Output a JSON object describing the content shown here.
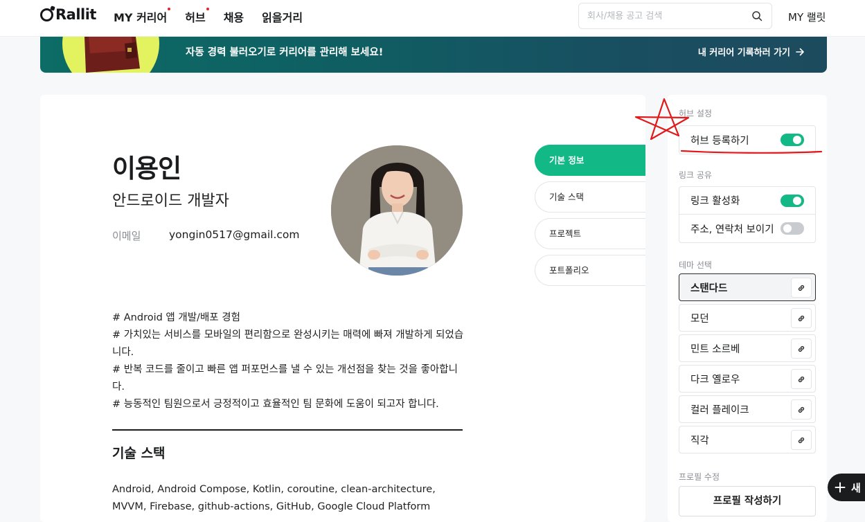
{
  "header": {
    "logo": "Rallit",
    "nav": [
      {
        "label": "MY 커리어",
        "dot": true
      },
      {
        "label": "허브",
        "dot": true
      },
      {
        "label": "채용",
        "dot": false
      },
      {
        "label": "읽을거리",
        "dot": false
      }
    ],
    "search_placeholder": "회사/채용 공고 검색",
    "my_rallit": "MY 랠릿"
  },
  "banner": {
    "text": "자동 경력 불러오기로 커리어를 관리해 보세요!",
    "link": "내 커리어 기록하러 가기"
  },
  "profile": {
    "name": "이용인",
    "role": "안드로이드 개발자",
    "email_label": "이메일",
    "email": "yongin0517@gmail.com",
    "intro": [
      "# Android 앱 개발/배포 경험",
      "# 가치있는 서비스를 모바일의 편리함으로 완성시키는 매력에 빠져 개발하게 되었습니다.",
      "# 반복 코드를 줄이고 빠른 앱 퍼포먼스를 낼 수 있는 개선점을 찾는 것을 좋아합니다.",
      "# 능동적인 팀원으로서 긍정적이고 효율적인 팀 문화에 도움이 되고자 합니다."
    ],
    "skills_title": "기술 스택",
    "skills": "Android, Android Compose, Kotlin, coroutine, clean-architecture, MVVM, Firebase, github-actions, GitHub, Google Cloud Platform"
  },
  "section_tabs": [
    {
      "label": "기본 정보",
      "active": true
    },
    {
      "label": "기술 스택",
      "active": false
    },
    {
      "label": "프로젝트",
      "active": false
    },
    {
      "label": "포트폴리오",
      "active": false
    }
  ],
  "settings": {
    "hub_label": "허브 설정",
    "hub_register": {
      "label": "허브 등록하기",
      "on": true
    },
    "link_label": "링크 공유",
    "link_active": {
      "label": "링크 활성화",
      "on": true
    },
    "contact_show": {
      "label": "주소, 연락처 보이기",
      "on": false
    },
    "theme_label": "테마 선택",
    "themes": [
      {
        "label": "스탠다드",
        "selected": true
      },
      {
        "label": "모던",
        "selected": false
      },
      {
        "label": "민트 소르베",
        "selected": false
      },
      {
        "label": "다크 옐로우",
        "selected": false
      },
      {
        "label": "컬러 플레이크",
        "selected": false
      },
      {
        "label": "직각",
        "selected": false
      }
    ],
    "profile_edit_label": "프로필 수정",
    "profile_edit_button": "프로필 작성하기"
  },
  "fab": {
    "label": "새"
  },
  "colors": {
    "accent": "#12b886",
    "annotation": "#e01a1a",
    "banner": "#0f5e62"
  }
}
